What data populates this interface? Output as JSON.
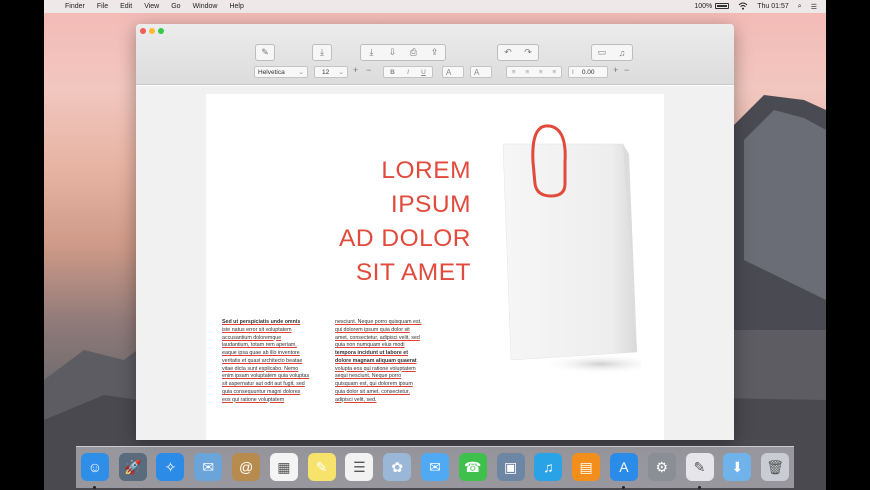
{
  "menubar": {
    "apple": "",
    "app": "Finder",
    "items": [
      "File",
      "Edit",
      "View",
      "Go",
      "Window",
      "Help"
    ],
    "battery": "100%",
    "clock": "Thu 01:57",
    "search_glyph": "⌕",
    "list_glyph": "☰"
  },
  "toolbar": {
    "font_name": "Helvetica",
    "font_size": "12",
    "plus": "+",
    "minus": "−",
    "bold": "B",
    "italic": "I",
    "underline": "U",
    "text_color": "A",
    "highlight": "A",
    "spacing": "0.00",
    "spacing_icon": "I"
  },
  "document": {
    "headline": [
      "LOREM",
      "IPSUM",
      "AD DOLOR",
      "SIT AMET"
    ],
    "col1": [
      {
        "t": "Sed ut perspiciatis unde omnis",
        "s": "bu"
      },
      {
        "t": "iste natus error sit voluptatem",
        "s": "u"
      },
      {
        "t": "accusantium doloremque",
        "s": "u"
      },
      {
        "t": "laudantium, totam rem aperiam,",
        "s": "u"
      },
      {
        "t": "eaque ipsa quae ab illo inventore",
        "s": "u"
      },
      {
        "t": "veritatis et quasi architecto beatae",
        "s": "u"
      },
      {
        "t": "vitae dicta sunt explicabo. Nemo",
        "s": "u"
      },
      {
        "t": "enim ipsam voluptatem quia voluptas",
        "s": "u"
      },
      {
        "t": "sit aspernatur aut odit aut fugit, sed",
        "s": "u"
      },
      {
        "t": "quia consequuntur magni dolores",
        "s": "u"
      },
      {
        "t": "eos qui ratione voluptatem",
        "s": "u"
      }
    ],
    "col2": [
      {
        "t": "nesciunt. Neque porro quisquam est,",
        "s": "u"
      },
      {
        "t": "qui dolorem ipsum quia dolor sit",
        "s": "u"
      },
      {
        "t": "amet, consectetur, adipisci velit, sed",
        "s": "u"
      },
      {
        "t": "quia non numquam eius modi",
        "s": "u"
      },
      {
        "t": "tempora incidunt ut labore et",
        "s": "bu"
      },
      {
        "t": "dolore magnam aliquam quaerat",
        "s": "bu"
      },
      {
        "t": "volupta eos qui ratione voluptatem",
        "s": "u"
      },
      {
        "t": "sequi nesciunt. Neque porro",
        "s": "u"
      },
      {
        "t": "quisquam est, qui dolorem ipsum",
        "s": "u"
      },
      {
        "t": "quia dolor sit amet, consectetur,",
        "s": "u"
      },
      {
        "t": "adipisci velit, sed.",
        "s": "u"
      }
    ]
  },
  "dock": {
    "apps": [
      {
        "name": "Finder",
        "glyph": "☺",
        "color": "#2f8fe8"
      },
      {
        "name": "Launchpad",
        "glyph": "🚀",
        "color": "#5a6b7e"
      },
      {
        "name": "Safari",
        "glyph": "✧",
        "color": "#2d8be8"
      },
      {
        "name": "Mail",
        "glyph": "✉",
        "color": "#6ba4d8"
      },
      {
        "name": "Contacts",
        "glyph": "@",
        "color": "#b78b4e"
      },
      {
        "name": "Calendar",
        "glyph": "▦",
        "color": "#f4f4f4"
      },
      {
        "name": "Notes",
        "glyph": "✎",
        "color": "#f7e26b"
      },
      {
        "name": "Reminders",
        "glyph": "☰",
        "color": "#f2f2f2"
      },
      {
        "name": "Photos",
        "glyph": "✿",
        "color": "#9ab7d8"
      },
      {
        "name": "Messages",
        "glyph": "✉",
        "color": "#4fa9f3"
      },
      {
        "name": "FaceTime",
        "glyph": "☎",
        "color": "#3fbf4c"
      },
      {
        "name": "iPhoto",
        "glyph": "▣",
        "color": "#6c86a4"
      },
      {
        "name": "iTunes",
        "glyph": "♫",
        "color": "#2aa2e6"
      },
      {
        "name": "iBooks",
        "glyph": "▤",
        "color": "#f28e1c"
      },
      {
        "name": "App Store",
        "glyph": "A",
        "color": "#2a8be8"
      },
      {
        "name": "System Preferences",
        "glyph": "⚙",
        "color": "#8a8f96"
      },
      {
        "name": "TextEdit",
        "glyph": "✎",
        "color": "#e6e6ea"
      },
      {
        "name": "Downloads",
        "glyph": "⬇",
        "color": "#6fb3ea"
      },
      {
        "name": "Trash",
        "glyph": "🗑",
        "color": "#c9cdd3"
      }
    ]
  }
}
